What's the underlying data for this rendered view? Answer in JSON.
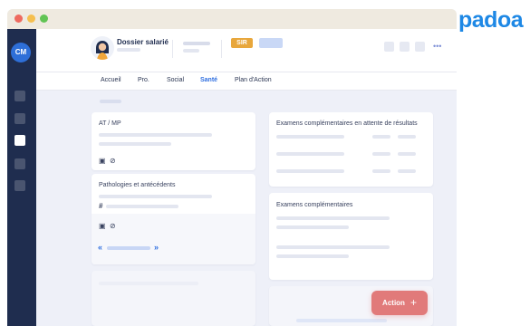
{
  "brand": {
    "logo_text": "padoa",
    "logo_color": "#1e88e5"
  },
  "window": {
    "controls": [
      "close",
      "minimize",
      "maximize"
    ],
    "control_colors": [
      "#ee6a5f",
      "#f5bf4f",
      "#61c454"
    ]
  },
  "sidebar": {
    "user_initials": "CM",
    "items": [
      "nav-item-1",
      "nav-item-2",
      "nav-item-3",
      "nav-item-4",
      "nav-item-5"
    ],
    "active_index": 2
  },
  "header": {
    "title": "Dossier salarié",
    "badge": "SIR",
    "more_icon": "ellipsis-icon"
  },
  "tabs": [
    {
      "label": "Accueil"
    },
    {
      "label": "Pro."
    },
    {
      "label": "Social"
    },
    {
      "label": "Santé",
      "active": true
    },
    {
      "label": "Plan d'Action"
    }
  ],
  "cards": {
    "at_mp": {
      "title": "AT / MP"
    },
    "pathologies": {
      "title": "Pathologies et antécédents",
      "hash": "#"
    },
    "exams_pending": {
      "title": "Examens complémentaires en attente de résultats"
    },
    "exams": {
      "title": "Examens complémentaires"
    }
  },
  "pagination": {
    "prev": "«",
    "next": "»"
  },
  "action_button": {
    "label": "Action",
    "icon": "+",
    "color": "#e17a7a"
  }
}
